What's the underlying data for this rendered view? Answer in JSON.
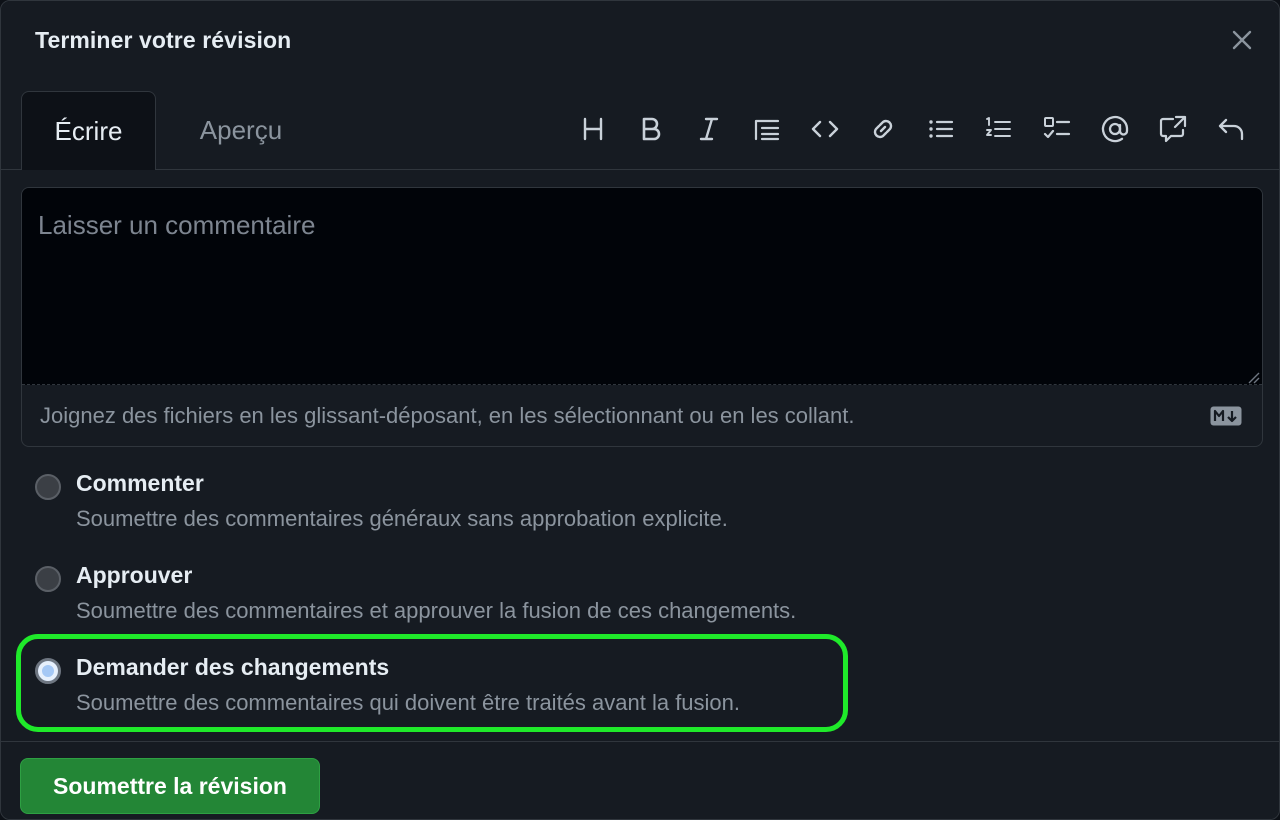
{
  "dialog": {
    "title": "Terminer votre révision"
  },
  "tabs": {
    "write": "Écrire",
    "preview": "Aperçu"
  },
  "toolbar": {
    "icons": [
      "heading-icon",
      "bold-icon",
      "italic-icon",
      "quote-icon",
      "code-icon",
      "link-icon",
      "unordered-list-icon",
      "ordered-list-icon",
      "task-list-icon",
      "mention-icon",
      "cross-reference-icon",
      "undo-icon"
    ]
  },
  "editor": {
    "placeholder": "Laisser un commentaire",
    "attach_hint": "Joignez des fichiers en les glissant-déposant, en les sélectionnant ou en les collant."
  },
  "options": [
    {
      "label": "Commenter",
      "description": "Soumettre des commentaires généraux sans approbation explicite.",
      "selected": false
    },
    {
      "label": "Approuver",
      "description": "Soumettre des commentaires et approuver la fusion de ces changements.",
      "selected": false
    },
    {
      "label": "Demander des changements",
      "description": "Soumettre des commentaires qui doivent être traités avant la fusion.",
      "selected": true
    }
  ],
  "footer": {
    "submit_label": "Soumettre la révision"
  },
  "colors": {
    "background": "#161b22",
    "editor_bg": "#010409",
    "border": "#30363d",
    "submit_green": "#238636",
    "highlight_green": "#1fea2a",
    "selected_radio": "#a5c8f5"
  }
}
